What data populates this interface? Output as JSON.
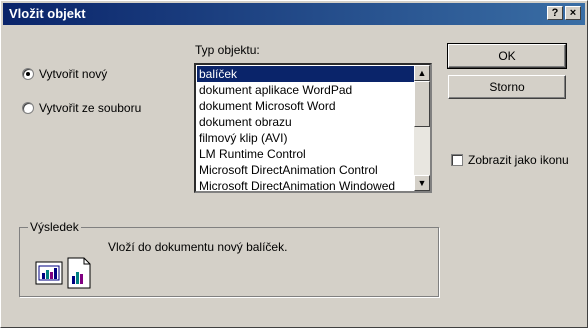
{
  "window": {
    "title": "Vložit objekt",
    "help_btn": "?",
    "close_btn": "×"
  },
  "options": {
    "new_label": "Vytvořit nový",
    "file_label": "Vytvořit ze souboru",
    "selected": "new"
  },
  "list": {
    "label": "Typ objektu:",
    "items": [
      "balíček",
      "dokument aplikace WordPad",
      "dokument Microsoft Word",
      "dokument obrazu",
      "filmový klip (AVI)",
      "LM Runtime Control",
      "Microsoft DirectAnimation Control",
      "Microsoft DirectAnimation Windowed"
    ],
    "selected_index": 0
  },
  "buttons": {
    "ok": "OK",
    "cancel": "Storno"
  },
  "display_icon": {
    "label": "Zobrazit jako ikonu",
    "checked": false
  },
  "result": {
    "label": "Výsledek",
    "text": "Vloží do dokumentu nový balíček."
  }
}
